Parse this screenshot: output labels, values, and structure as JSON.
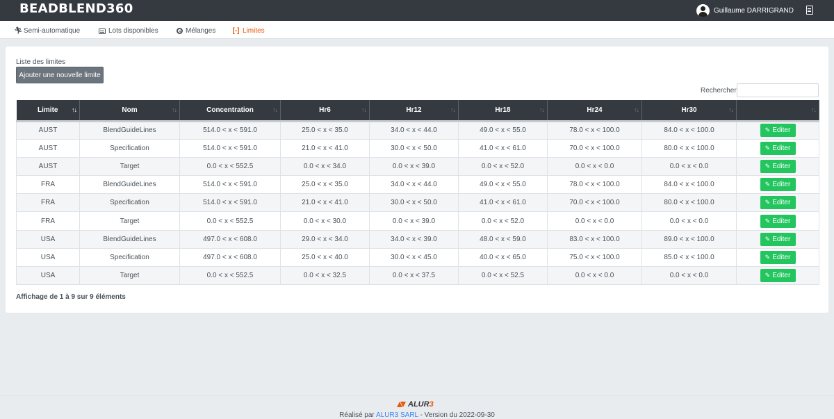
{
  "header": {
    "brand": "BEADBLEND360",
    "user_name": "Guillaume DARRIGRAND"
  },
  "nav": [
    {
      "label": "Semi-automatique",
      "icon": "running-person-icon"
    },
    {
      "label": "Lots disponibles",
      "icon": "list-box-icon"
    },
    {
      "label": "Mélanges",
      "icon": "target-circle-icon"
    },
    {
      "label": "Limites",
      "icon": "brackets-icon",
      "active": true
    }
  ],
  "main": {
    "title": "Liste des limites",
    "add_button": "Ajouter une nouvelle limite",
    "search_label": "Rechercher:",
    "search_value": "",
    "columns": [
      "Limite",
      "Nom",
      "Concentration",
      "Hr6",
      "Hr12",
      "Hr18",
      "Hr24",
      "Hr30",
      ""
    ],
    "edit_label": "Editer",
    "rows": [
      [
        "AUST",
        "BlendGuideLines",
        "514.0 < x < 591.0",
        "25.0 < x < 35.0",
        "34.0 < x < 44.0",
        "49.0 < x < 55.0",
        "78.0 < x < 100.0",
        "84.0 < x < 100.0"
      ],
      [
        "AUST",
        "Specification",
        "514.0 < x < 591.0",
        "21.0 < x < 41.0",
        "30.0 < x < 50.0",
        "41.0 < x < 61.0",
        "70.0 < x < 100.0",
        "80.0 < x < 100.0"
      ],
      [
        "AUST",
        "Target",
        "0.0 < x < 552.5",
        "0.0 < x < 34.0",
        "0.0 < x < 39.0",
        "0.0 < x < 52.0",
        "0.0 < x < 0.0",
        "0.0 < x < 0.0"
      ],
      [
        "FRA",
        "BlendGuideLines",
        "514.0 < x < 591.0",
        "25.0 < x < 35.0",
        "34.0 < x < 44.0",
        "49.0 < x < 55.0",
        "78.0 < x < 100.0",
        "84.0 < x < 100.0"
      ],
      [
        "FRA",
        "Specification",
        "514.0 < x < 591.0",
        "21.0 < x < 41.0",
        "30.0 < x < 50.0",
        "41.0 < x < 61.0",
        "70.0 < x < 100.0",
        "80.0 < x < 100.0"
      ],
      [
        "FRA",
        "Target",
        "0.0 < x < 552.5",
        "0.0 < x < 30.0",
        "0.0 < x < 39.0",
        "0.0 < x < 52.0",
        "0.0 < x < 0.0",
        "0.0 < x < 0.0"
      ],
      [
        "USA",
        "BlendGuideLines",
        "497.0 < x < 608.0",
        "29.0 < x < 34.0",
        "34.0 < x < 39.0",
        "48.0 < x < 59.0",
        "83.0 < x < 100.0",
        "89.0 < x < 100.0"
      ],
      [
        "USA",
        "Specification",
        "497.0 < x < 608.0",
        "25.0 < x < 40.0",
        "30.0 < x < 45.0",
        "40.0 < x < 65.0",
        "75.0 < x < 100.0",
        "85.0 < x < 100.0"
      ],
      [
        "USA",
        "Target",
        "0.0 < x < 552.5",
        "0.0 < x < 32.5",
        "0.0 < x < 37.5",
        "0.0 < x < 52.5",
        "0.0 < x < 0.0",
        "0.0 < x < 0.0"
      ]
    ],
    "info": "Affichage de 1 à 9 sur 9 éléments"
  },
  "footer": {
    "logo_prefix": "ALUR",
    "logo_suffix": "3",
    "credits_before": "Réalisé par ",
    "credits_link": "ALUR3 SARL",
    "credits_after": " - Version du 2022-09-30"
  },
  "colors": {
    "topbar": "#343a40",
    "accent": "#e8590c",
    "edit_button": "#22c55e",
    "add_button": "#6c757d"
  }
}
